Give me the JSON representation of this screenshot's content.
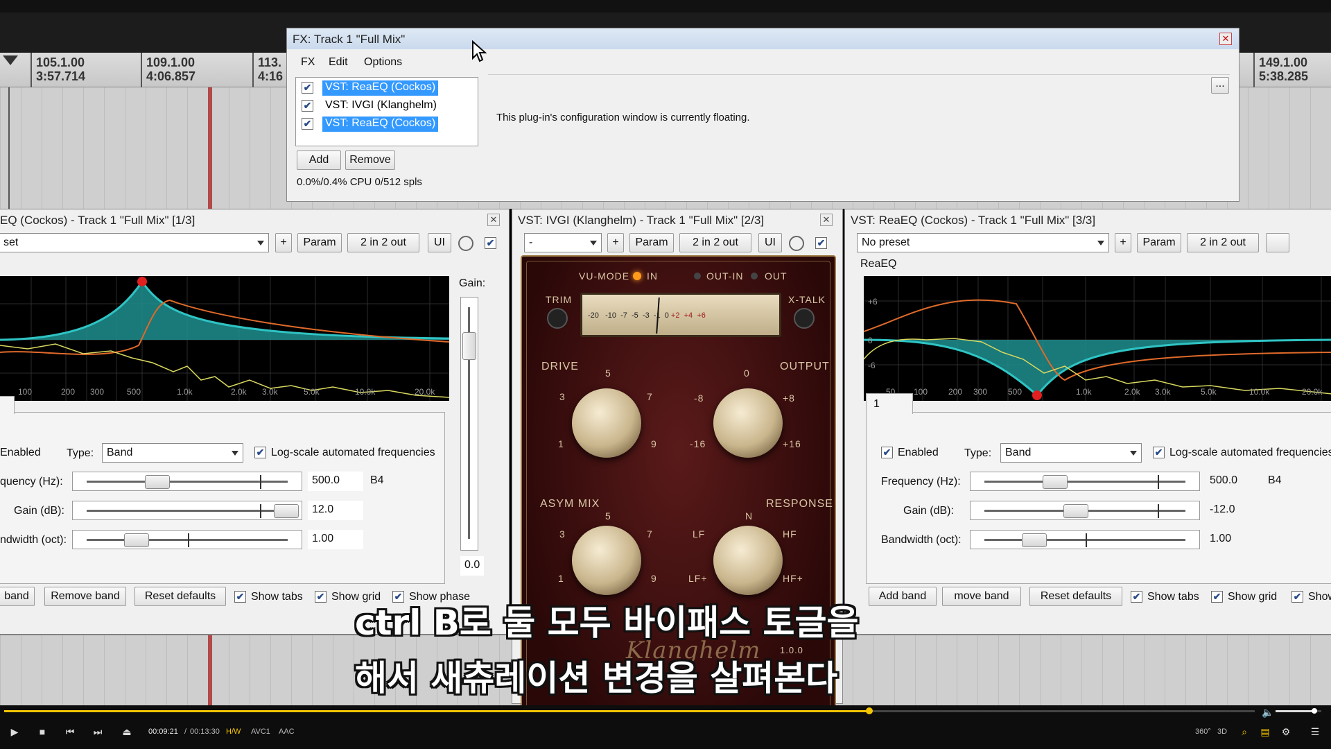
{
  "timeline": {
    "markers": [
      {
        "beat": "105.1.00",
        "time": "3:57.714"
      },
      {
        "beat": "109.1.00",
        "time": "4:06.857"
      },
      {
        "beat": "113.",
        "time": "4:16"
      },
      {
        "beat": "149.1.00",
        "time": "5:38.285"
      }
    ]
  },
  "fx_chain": {
    "title": "FX: Track 1 \"Full Mix\"",
    "menu": [
      "FX",
      "Edit",
      "Options"
    ],
    "plugins": [
      {
        "name": "VST: ReaEQ (Cockos)",
        "enabled": true,
        "selected": true
      },
      {
        "name": "VST: IVGI (Klanghelm)",
        "enabled": true,
        "selected": false
      },
      {
        "name": "VST: ReaEQ (Cockos)",
        "enabled": true,
        "selected": true
      }
    ],
    "add_label": "Add",
    "remove_label": "Remove",
    "cpu_text": "0.0%/0.4% CPU 0/512 spls",
    "floating_msg": "This plug-in's configuration window is currently floating.",
    "more_label": "..."
  },
  "eq1": {
    "title": "EQ (Cockos) - Track 1 \"Full Mix\" [1/3]",
    "preset": "set",
    "plus": "+",
    "param": "Param",
    "io": "2 in 2 out",
    "ui": "UI",
    "gain_label": "Gain:",
    "gain_value": "0.0",
    "freq_ticks": [
      "100",
      "200",
      "300",
      "500",
      "1.0k",
      "2.0k",
      "3.0k",
      "5.0k",
      "10.0k",
      "20.0k"
    ],
    "enabled_label": "Enabled",
    "type_label": "Type:",
    "type_value": "Band",
    "logscale_label": "Log-scale automated frequencies",
    "freq_label": "quency (Hz):",
    "freq_value": "500.0",
    "freq_note": "B4",
    "gain_db_label": "Gain (dB):",
    "gain_db_value": "12.0",
    "bw_label": "ndwidth (oct):",
    "bw_value": "1.00",
    "add_band": "band",
    "remove_band": "Remove band",
    "reset": "Reset defaults",
    "show_tabs": "Show tabs",
    "show_grid": "Show grid",
    "show_phase": "Show phase"
  },
  "ivgi": {
    "title": "VST: IVGI (Klanghelm) - Track 1 \"Full Mix\" [2/3]",
    "preset": "-",
    "plus": "+",
    "param": "Param",
    "io": "2 in 2 out",
    "ui": "UI",
    "vu_mode": "VU-MODE",
    "in": "IN",
    "out_in": "OUT-IN",
    "out": "OUT",
    "trim": "TRIM",
    "xtalk": "X-TALK",
    "drive": "DRIVE",
    "output": "OUTPUT",
    "asym_mix": "ASYM MIX",
    "response": "RESPONSE",
    "vu_scale": [
      "-20",
      "-10",
      "-7",
      "-5",
      "-3",
      "-1",
      "0",
      "+2",
      "+4",
      "+6"
    ],
    "drive_scale": [
      "1",
      "3",
      "5",
      "7",
      "9"
    ],
    "output_scale": [
      "-16",
      "-8",
      "0",
      "+8",
      "+16"
    ],
    "asym_scale": [
      "1",
      "3",
      "5",
      "7",
      "9"
    ],
    "response_scale": [
      "LF+",
      "LF",
      "N",
      "HF",
      "HF+"
    ],
    "brand": "Klanghelm",
    "version": "1.0.0"
  },
  "eq3": {
    "title": "VST: ReaEQ (Cockos) - Track 1 \"Full Mix\" [3/3]",
    "preset": "No preset",
    "plus": "+",
    "param": "Param",
    "io": "2 in 2 out",
    "plugin_name": "ReaEQ",
    "db_ticks": [
      "+6",
      "0",
      "-6"
    ],
    "freq_ticks": [
      "50",
      "100",
      "200",
      "300",
      "500",
      "1.0k",
      "2.0k",
      "3.0k",
      "5.0k",
      "10.0k",
      "20.0k"
    ],
    "tab_label": "1",
    "enabled_label": "Enabled",
    "type_label": "Type:",
    "type_value": "Band",
    "logscale_label": "Log-scale automated frequencies",
    "freq_label": "Frequency (Hz):",
    "freq_value": "500.0",
    "freq_note": "B4",
    "gain_db_label": "Gain (dB):",
    "gain_db_value": "-12.0",
    "bw_label": "Bandwidth (oct):",
    "bw_value": "1.00",
    "add_band": "Add band",
    "remove_band": "move band",
    "reset": "Reset defaults",
    "show_tabs": "Show tabs",
    "show_grid": "Show grid",
    "show_phase": "Show"
  },
  "subtitles": {
    "line1": "ctrl B로 둘 모두 바이패스 토글을",
    "line2": "해서 새츄레이션 변경을 살펴본다"
  },
  "player": {
    "current_time": "00:09:21",
    "separator": "/",
    "total_time": "00:13:30",
    "hw": "H/W",
    "vcodec": "AVC1",
    "acodec": "AAC",
    "progress": 0.692,
    "volume": 0.85,
    "icons": [
      "play-icon",
      "stop-icon",
      "prev-icon",
      "next-icon",
      "eject-icon",
      "360-icon",
      "3d-icon",
      "zoom-icon",
      "subtitle-icon",
      "settings-icon",
      "menu-icon"
    ],
    "labels_360": "360°",
    "labels_3d": "3D"
  },
  "colors": {
    "selection": "#3399ff",
    "eq_cyan": "#2fc4c4",
    "eq_orange": "#e06a2a",
    "eq_yellow": "#d8d860",
    "seek_accent": "#f3c400"
  }
}
